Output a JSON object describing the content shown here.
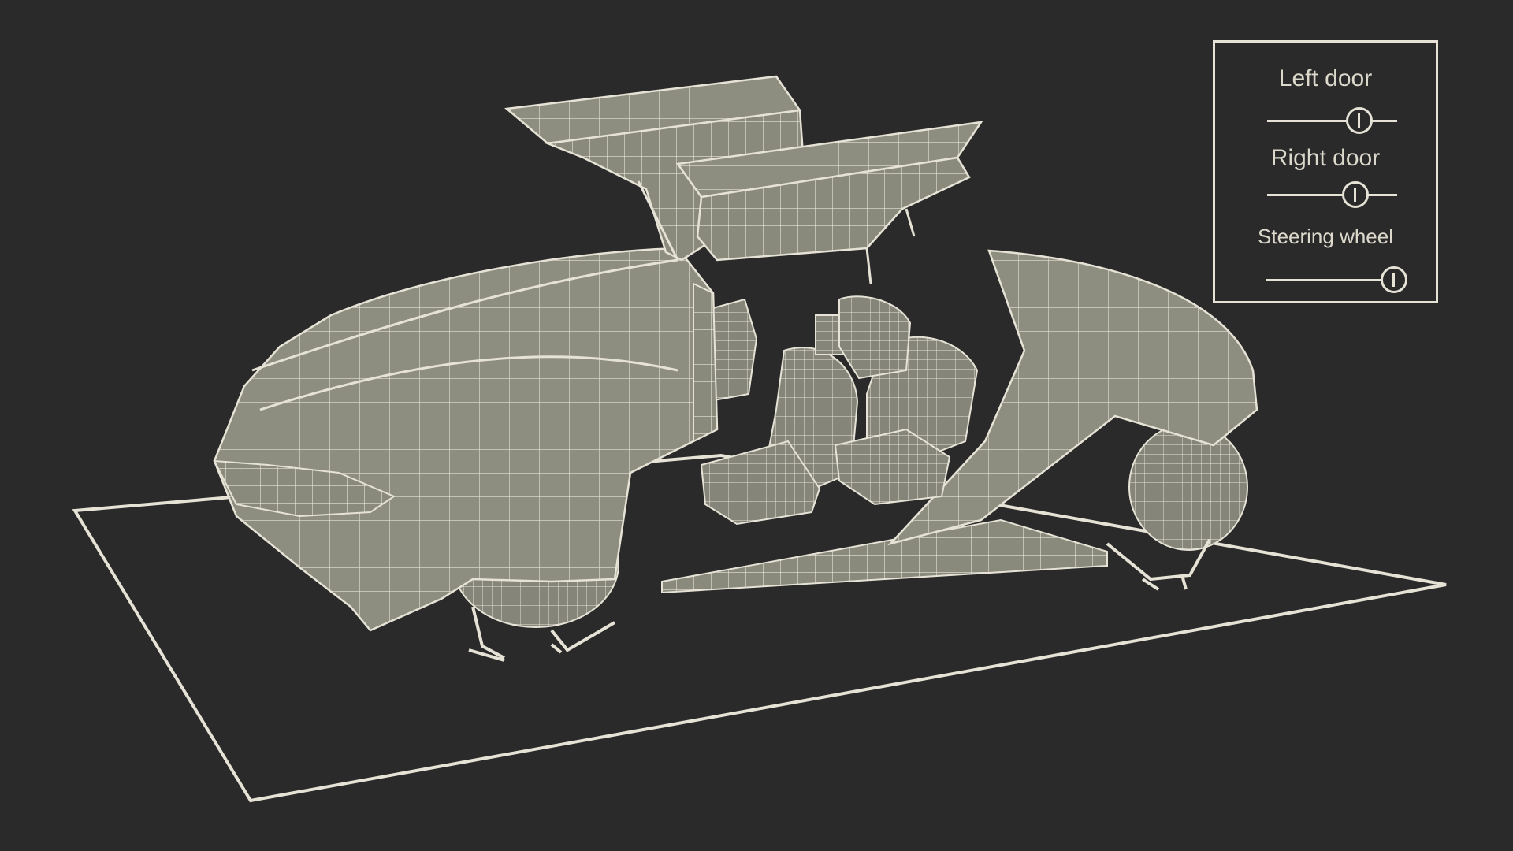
{
  "scene": {
    "background": "#2a2a2a",
    "wireframe_fill": "#8a8a7c",
    "wireframe_line": "#e6e3d6"
  },
  "controls": {
    "left_door": {
      "label": "Left door",
      "value": 0.71
    },
    "right_door": {
      "label": "Right door",
      "value": 0.68
    },
    "steering_wheel": {
      "label": "Steering wheel",
      "value": 0.98
    }
  }
}
